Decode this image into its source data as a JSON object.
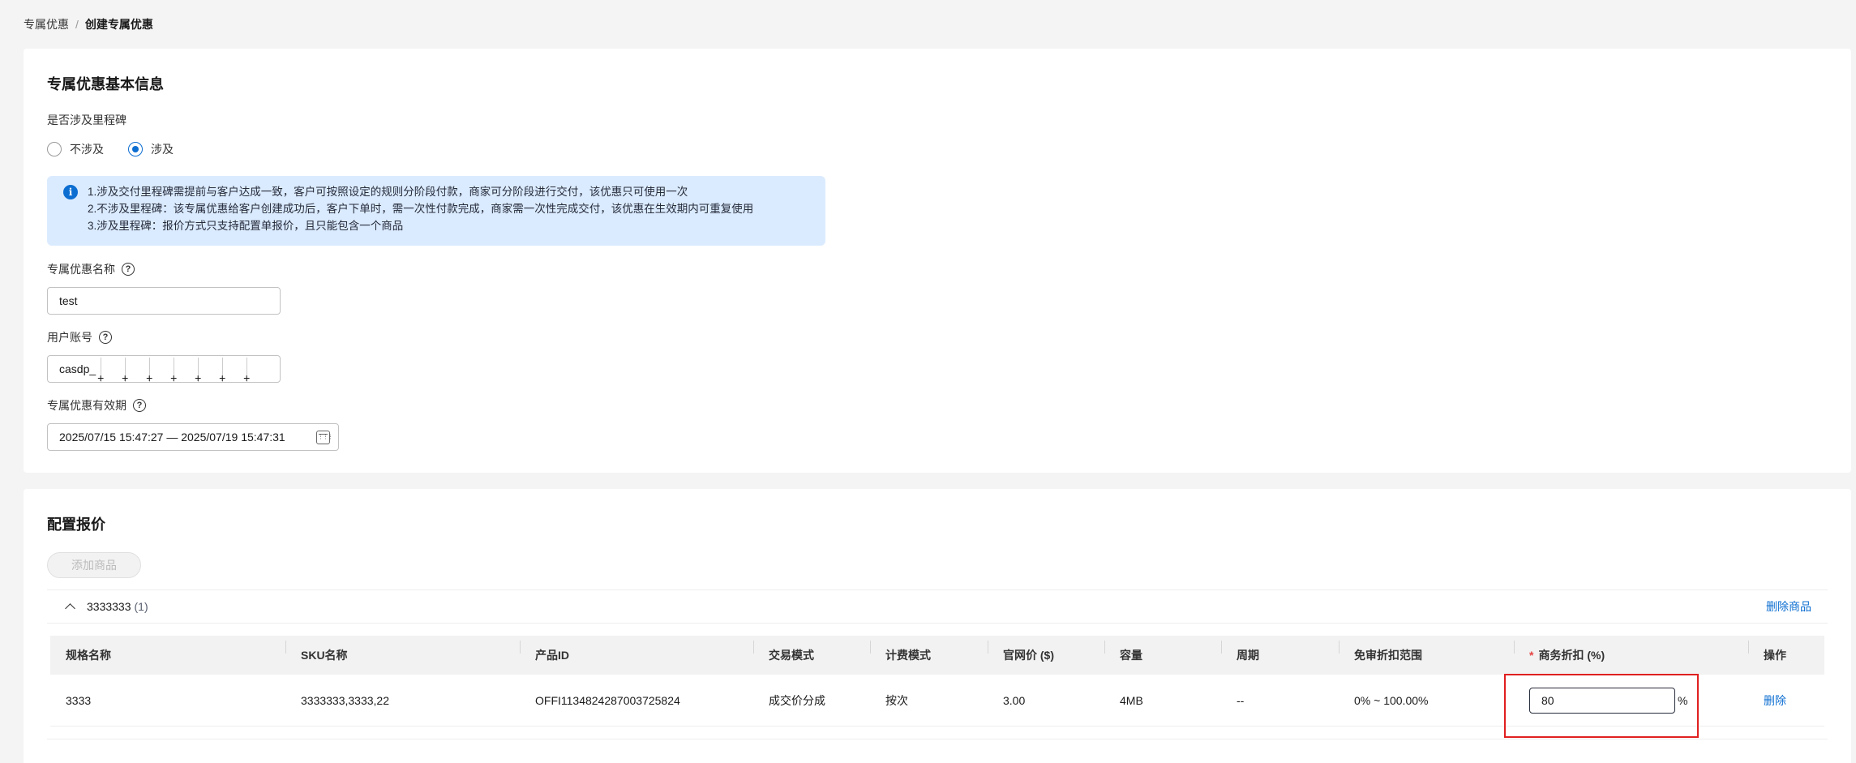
{
  "breadcrumb": {
    "parent": "专属优惠",
    "separator": "/",
    "current": "创建专属优惠"
  },
  "basic_info": {
    "title": "专属优惠基本信息",
    "milestone": {
      "label": "是否涉及里程碑",
      "options": [
        {
          "label": "不涉及",
          "checked": false
        },
        {
          "label": "涉及",
          "checked": true
        }
      ]
    },
    "info": {
      "lines": [
        "1.涉及交付里程碑需提前与客户达成一致，客户可按照设定的规则分阶段付款，商家可分阶段进行交付，该优惠只可使用一次",
        "2.不涉及里程碑：该专属优惠给客户创建成功后，客户下单时，需一次性付款完成，商家需一次性完成交付，该优惠在生效期内可重复使用",
        "3.涉及里程碑：报价方式只支持配置单报价，且只能包含一个商品"
      ]
    },
    "name_field": {
      "label": "专属优惠名称",
      "value": "test"
    },
    "account_field": {
      "label": "用户账号",
      "value": "casdp_"
    },
    "validity_field": {
      "label": "专属优惠有效期",
      "value": "2025/07/15 15:47:27 — 2025/07/19 15:47:31"
    }
  },
  "pricing": {
    "title": "配置报价",
    "add_button": "添加商品",
    "group": {
      "name": "3333333",
      "count": "(1)",
      "delete_product": "删除商品"
    },
    "columns": [
      "规格名称",
      "SKU名称",
      "产品ID",
      "交易模式",
      "计费模式",
      "官网价 ($)",
      "容量",
      "周期",
      "免审折扣范围",
      "商务折扣 (%)",
      "操作"
    ],
    "rows": [
      {
        "spec": "3333",
        "sku": "3333333,3333,22",
        "product_id": "OFFI1134824287003725824",
        "trade_mode": "成交价分成",
        "billing_mode": "按次",
        "price": "3.00",
        "capacity": "4MB",
        "period": "--",
        "range": "0% ~ 100.00%",
        "discount": "80",
        "discount_unit": "%",
        "action": "删除"
      }
    ],
    "required_mark": "*"
  },
  "colors": {
    "primary": "#0d6ed1",
    "info_bg": "#dbebff",
    "highlight": "#e02020"
  }
}
